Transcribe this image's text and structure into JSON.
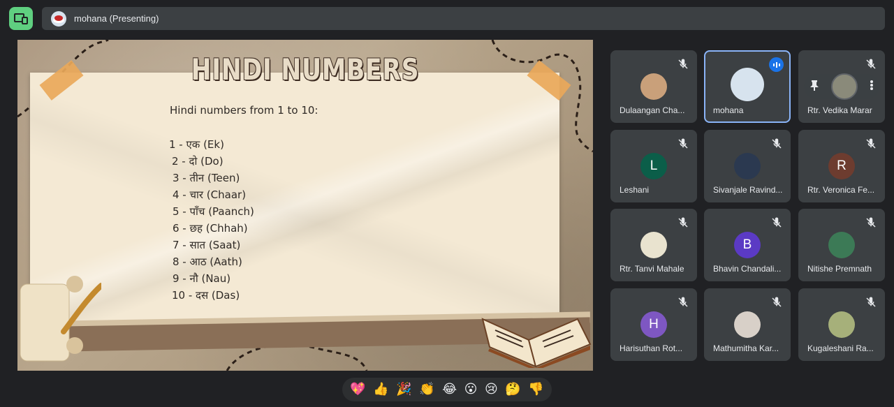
{
  "presenter": {
    "name": "mohana (Presenting)"
  },
  "slide": {
    "title": "HINDI NUMBERS",
    "intro": "Hindi numbers from 1 to 10:",
    "numbers": [
      "1 - एक (Ek)",
      "2 - दो (Do)",
      "3 - तीन (Teen)",
      "4 - चार (Chaar)",
      "5 - पाँच (Paanch)",
      "6 - छह (Chhah)",
      "7 - सात (Saat)",
      "8 - आठ (Aath)",
      "9 - नौ (Nau)",
      "10 - दस (Das)"
    ]
  },
  "participants": [
    {
      "name": "Dulaangan Cha...",
      "avatar_type": "photo",
      "avatar_color": "#c9a07a"
    },
    {
      "name": "mohana",
      "avatar_type": "photo",
      "avatar_color": "#d7e3ee",
      "speaking": true
    },
    {
      "name": "Rtr. Vedika Marar",
      "avatar_type": "photo",
      "avatar_color": "#8a8a7a",
      "hover_controls": true
    },
    {
      "name": "Leshani",
      "avatar_type": "initial",
      "initial": "L",
      "avatar_color": "#0b5e49"
    },
    {
      "name": "Sivanjale Ravind...",
      "avatar_type": "photo",
      "avatar_color": "#2b3950"
    },
    {
      "name": "Rtr. Veronica Fe...",
      "avatar_type": "initial",
      "initial": "R",
      "avatar_color": "#6d3c2f"
    },
    {
      "name": "Rtr. Tanvi Mahale",
      "avatar_type": "photo",
      "avatar_color": "#e9e3cf"
    },
    {
      "name": "Bhavin Chandali...",
      "avatar_type": "initial",
      "initial": "B",
      "avatar_color": "#5b3ac4"
    },
    {
      "name": "Nitishe Premnath",
      "avatar_type": "photo",
      "avatar_color": "#3c7a56"
    },
    {
      "name": "Harisuthan Rot...",
      "avatar_type": "initial",
      "initial": "H",
      "avatar_color": "#7e57c2"
    },
    {
      "name": "Mathumitha Kar...",
      "avatar_type": "photo",
      "avatar_color": "#d8d0c8"
    },
    {
      "name": "Kugaleshani Ra...",
      "avatar_type": "photo",
      "avatar_color": "#a6b07a"
    }
  ],
  "reactions": [
    "💖",
    "👍",
    "🎉",
    "👏",
    "😂",
    "😮",
    "😢",
    "🤔",
    "👎"
  ]
}
